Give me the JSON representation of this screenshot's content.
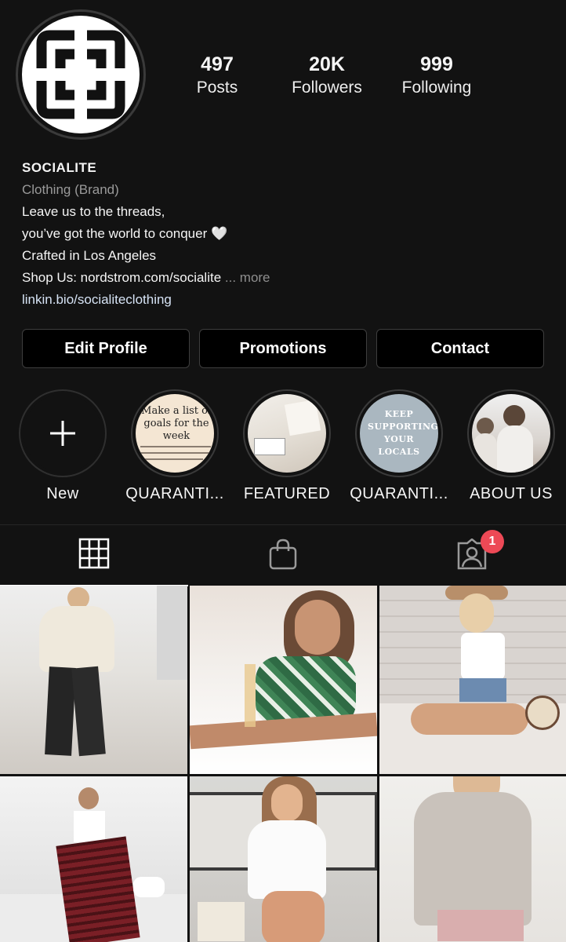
{
  "profile": {
    "username": "SOCIALITE",
    "category": "Clothing (Brand)",
    "bio_lines": [
      "Leave us to the threads,",
      "you’ve got the world to conquer 🤍",
      "Crafted in Los Angeles"
    ],
    "shop_line": "Shop Us: nordstrom.com/socialite",
    "more_label": "... more",
    "link": "linkin.bio/socialiteclothing"
  },
  "stats": [
    {
      "value": "497",
      "label": "Posts"
    },
    {
      "value": "20K",
      "label": "Followers"
    },
    {
      "value": "999",
      "label": "Following"
    }
  ],
  "buttons": {
    "edit_profile": "Edit Profile",
    "promotions": "Promotions",
    "contact": "Contact"
  },
  "highlights": [
    {
      "label": "New",
      "icon": "plus-icon"
    },
    {
      "label": "QUARANTI...",
      "text": "Make a list of goals for the week"
    },
    {
      "label": "FEATURED"
    },
    {
      "label": "QUARANTI...",
      "text": "KEEP SUPPORTING YOUR LOCALS"
    },
    {
      "label": "ABOUT US"
    }
  ],
  "tabs": {
    "grid_icon": "grid-icon",
    "shop_icon": "shopping-bag-icon",
    "tagged_icon": "tagged-user-icon",
    "tagged_badge": "1"
  },
  "colors": {
    "background": "#121212",
    "badge": "#ed4956",
    "link": "#d6e3f5"
  }
}
